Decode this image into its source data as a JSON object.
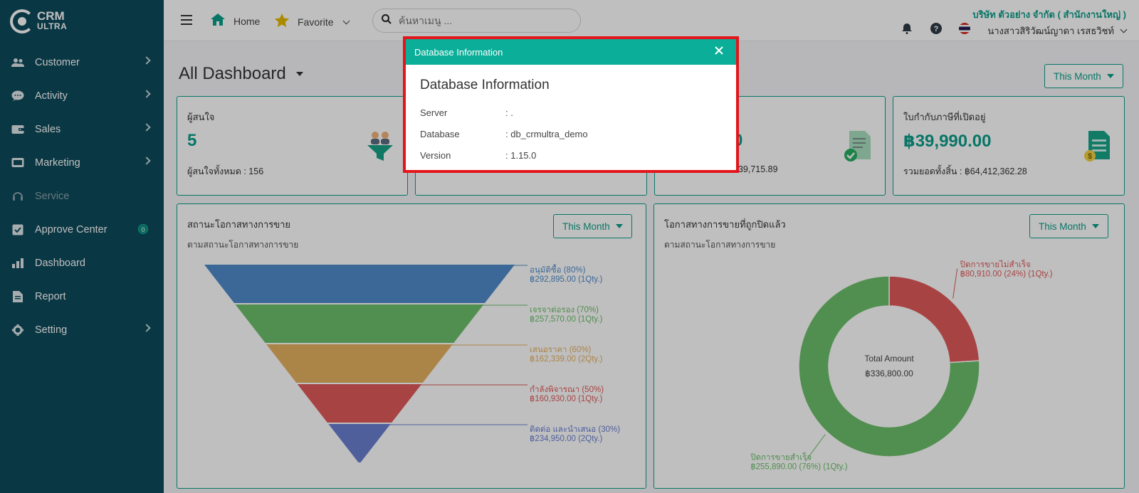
{
  "app": {
    "logo_line1": "CRM",
    "logo_line2": "ULTRA"
  },
  "sidebar": {
    "items": [
      {
        "label": "Customer",
        "icon": "users-icon",
        "has_chevron": true
      },
      {
        "label": "Activity",
        "icon": "chat-icon",
        "has_chevron": true
      },
      {
        "label": "Sales",
        "icon": "wallet-icon",
        "has_chevron": true
      },
      {
        "label": "Marketing",
        "icon": "billboard-icon",
        "has_chevron": true
      },
      {
        "label": "Service",
        "icon": "headset-icon",
        "disabled": true
      },
      {
        "label": "Approve Center",
        "icon": "check-square-icon",
        "badge": "0"
      },
      {
        "label": "Dashboard",
        "icon": "bar-chart-icon"
      },
      {
        "label": "Report",
        "icon": "document-icon"
      },
      {
        "label": "Setting",
        "icon": "gear-icon",
        "has_chevron": true
      }
    ]
  },
  "topbar": {
    "home_label": "Home",
    "favorite_label": "Favorite",
    "search_placeholder": "ค้นหาเมนู ...",
    "company": "บริษัท ตัวอย่าง จำกัด ( สำนักงานใหญ่ )",
    "user_name": "นางสาวสิริวัฒน์ญาดา เรสธวิชท์"
  },
  "main": {
    "title": "All Dashboard",
    "period_label": "This Month",
    "kpis": [
      {
        "title": "ผู้สนใจ",
        "value": "5",
        "sub": "ผู้สนใจทั้งหมด : 156",
        "icon": "funnel-users-icon"
      },
      {
        "title": "",
        "value": "",
        "sub": "",
        "icon": ""
      },
      {
        "title": "",
        "value": ".00",
        "sub": "039,715.89",
        "icon": "approved-document-icon"
      },
      {
        "title": "ใบกำกับภาษีที่เปิดอยู่",
        "value": "฿39,990.00",
        "sub": "รวมยอดทั้งสิ้น : ฿64,412,362.28",
        "icon": "invoice-money-icon"
      }
    ],
    "funnel_panel": {
      "title": "สถานะโอกาสทางการขาย",
      "subtitle": "ตามสถานะโอกาสทางการขาย",
      "period_label": "This Month"
    },
    "donut_panel": {
      "title": "โอกาสทางการขายที่ถูกปิดแล้ว",
      "subtitle": "ตามสถานะโอกาสทางการขาย",
      "period_label": "This Month"
    }
  },
  "chart_data": [
    {
      "type": "funnel",
      "stages": [
        {
          "name": "อนุมัติซื้อ (80%)",
          "amount_label": "฿292,895.00 (1Qty.)",
          "amount": 292895,
          "qty": 1,
          "color": "#4f8bc9"
        },
        {
          "name": "เจรจาต่อรอง (70%)",
          "amount_label": "฿257,570.00 (1Qty.)",
          "amount": 257570,
          "qty": 1,
          "color": "#6cbf6b"
        },
        {
          "name": "เสนอราคา (60%)",
          "amount_label": "฿162,339.00 (2Qty.)",
          "amount": 162339,
          "qty": 2,
          "color": "#e5b060"
        },
        {
          "name": "กำลังพิจารณา (50%)",
          "amount_label": "฿160,930.00 (1Qty.)",
          "amount": 160930,
          "qty": 1,
          "color": "#e05a5a"
        },
        {
          "name": "ติดต่อ และนำเสนอ (30%)",
          "amount_label": "฿234,950.00 (2Qty.)",
          "amount": 234950,
          "qty": 2,
          "color": "#6a7fd1"
        }
      ]
    },
    {
      "type": "pie",
      "center_title": "Total Amount",
      "center_value": "฿336,800.00",
      "slices": [
        {
          "name": "ปิดการขายไม่สำเร็จ",
          "amount_label": "฿80,910.00 (24%) (1Qty.)",
          "value": 24,
          "color": "#e05a5a"
        },
        {
          "name": "ปิดการขายสำเร็จ",
          "amount_label": "฿255,890.00 (76%) (1Qty.)",
          "value": 76,
          "color": "#6cbf6b"
        }
      ]
    }
  ],
  "modal": {
    "header_title": "Database Information",
    "heading": "Database Information",
    "rows": [
      {
        "label": "Server",
        "value": ": ."
      },
      {
        "label": "Database",
        "value": ": db_crmultra_demo"
      },
      {
        "label": "Version",
        "value": ": 1.15.0"
      }
    ]
  }
}
